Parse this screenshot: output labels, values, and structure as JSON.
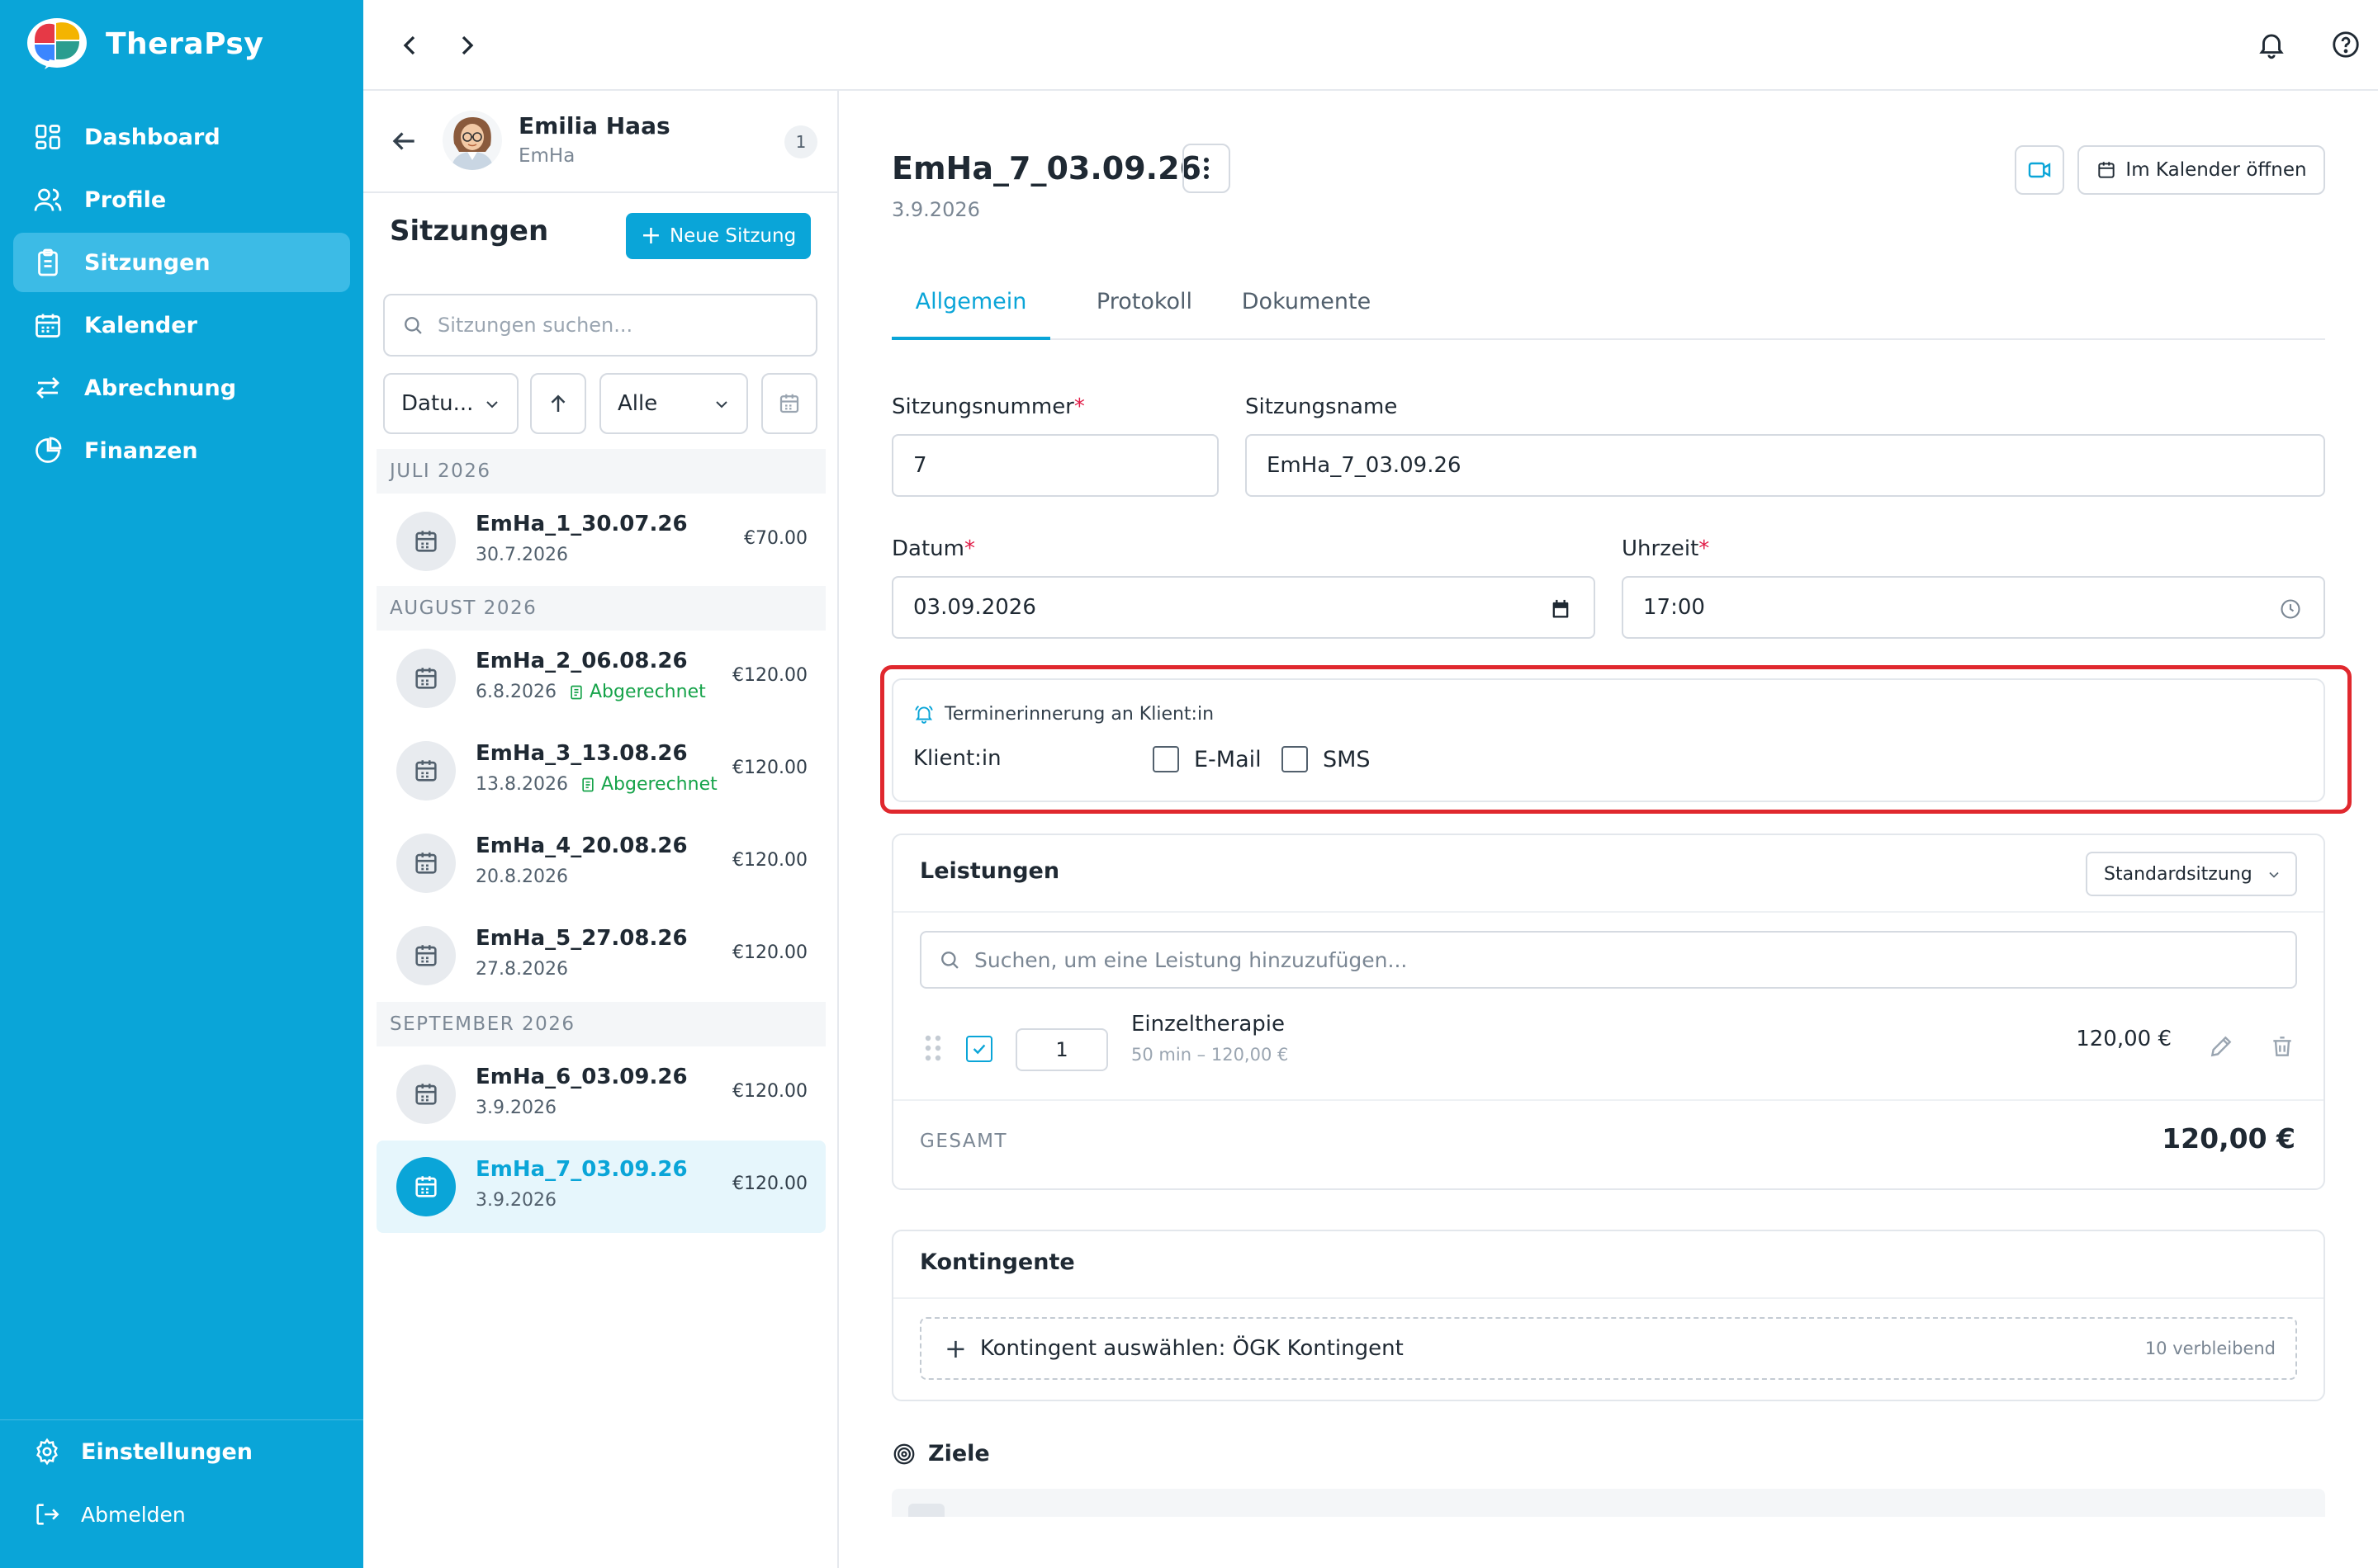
{
  "app": {
    "name": "TheraPsy"
  },
  "sidebar": {
    "items": [
      {
        "label": "Dashboard",
        "icon": "dashboard-icon",
        "active": false
      },
      {
        "label": "Profile",
        "icon": "users-icon",
        "active": false
      },
      {
        "label": "Sitzungen",
        "icon": "clipboard-icon",
        "active": true
      },
      {
        "label": "Kalender",
        "icon": "calendar-icon",
        "active": false
      },
      {
        "label": "Abrechnung",
        "icon": "exchange-icon",
        "active": false
      },
      {
        "label": "Finanzen",
        "icon": "pie-chart-icon",
        "active": false
      }
    ],
    "settings_label": "Einstellungen",
    "logout_label": "Abmelden"
  },
  "client": {
    "name": "Emilia Haas",
    "short": "EmHa",
    "count": "1"
  },
  "sessions_panel": {
    "title": "Sitzungen",
    "new_button": "Neue Sitzung",
    "search_placeholder": "Sitzungen suchen...",
    "sort_select": "Datu...",
    "status_select": "Alle"
  },
  "session_groups": [
    {
      "label": "JULI 2026",
      "sessions": [
        {
          "name": "EmHa_1_30.07.26",
          "date": "30.7.2026",
          "price": "€70.00",
          "billed": ""
        }
      ]
    },
    {
      "label": "AUGUST 2026",
      "sessions": [
        {
          "name": "EmHa_2_06.08.26",
          "date": "6.8.2026",
          "price": "€120.00",
          "billed": "Abgerechnet"
        },
        {
          "name": "EmHa_3_13.08.26",
          "date": "13.8.2026",
          "price": "€120.00",
          "billed": "Abgerechnet"
        },
        {
          "name": "EmHa_4_20.08.26",
          "date": "20.8.2026",
          "price": "€120.00",
          "billed": ""
        },
        {
          "name": "EmHa_5_27.08.26",
          "date": "27.8.2026",
          "price": "€120.00",
          "billed": ""
        }
      ]
    },
    {
      "label": "SEPTEMBER 2026",
      "sessions": [
        {
          "name": "EmHa_6_03.09.26",
          "date": "3.9.2026",
          "price": "€120.00",
          "billed": ""
        },
        {
          "name": "EmHa_7_03.09.26",
          "date": "3.9.2026",
          "price": "€120.00",
          "billed": "",
          "active": true
        }
      ]
    }
  ],
  "detail": {
    "title": "EmHa_7_03.09.26",
    "date": "3.9.2026",
    "calendar_button": "Im Kalender öffnen",
    "tabs": [
      "Allgemein",
      "Protokoll",
      "Dokumente"
    ],
    "active_tab": "Allgemein",
    "fields": {
      "number_label": "Sitzungsnummer",
      "number_value": "7",
      "name_label": "Sitzungsname",
      "name_value": "EmHa_7_03.09.26",
      "date_label": "Datum",
      "date_value": "03.09.2026",
      "time_label": "Uhrzeit",
      "time_value": "17:00",
      "required_mark": "*"
    },
    "reminder": {
      "title": "Terminerinnerung an Klient:in",
      "label": "Klient:in",
      "options": [
        {
          "label": "E-Mail",
          "checked": false
        },
        {
          "label": "SMS",
          "checked": false
        }
      ]
    },
    "services": {
      "title": "Leistungen",
      "template_select": "Standardsitzung",
      "search_placeholder": "Suchen, um eine Leistung hinzuzufügen...",
      "items": [
        {
          "qty": "1",
          "name": "Einzeltherapie",
          "meta": "50 min – 120,00 €",
          "price": "120,00 €",
          "checked": true
        }
      ],
      "total_label": "GESAMT",
      "total_value": "120,00 €"
    },
    "contingents": {
      "title": "Kontingente",
      "select_label": "Kontingent auswählen: ÖGK Kontingent",
      "remaining": "10 verbleibend"
    },
    "goals": {
      "title": "Ziele"
    }
  },
  "colors": {
    "brand": "#0AA5D8",
    "sidebar_active": "#3CBBE6",
    "success": "#16a34a",
    "required": "#e11d48",
    "highlight": "#e0282e"
  }
}
